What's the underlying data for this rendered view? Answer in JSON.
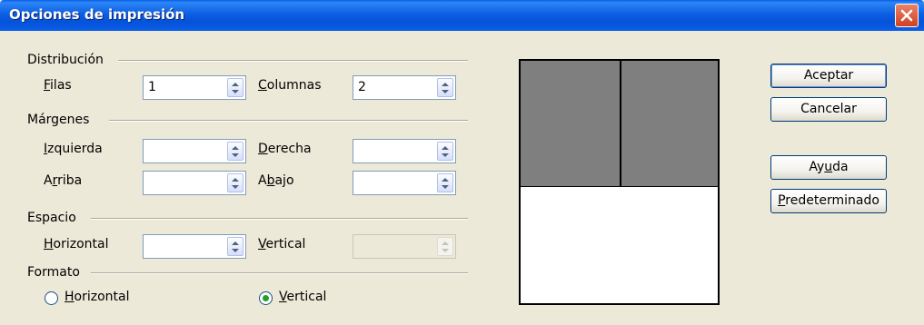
{
  "window": {
    "title": "Opciones de impresión"
  },
  "distribucion": {
    "group_label": "Distribución",
    "filas_label": "Filas",
    "filas_value": "1",
    "columnas_label": "Columnas",
    "columnas_value": "2"
  },
  "margenes": {
    "group_label": "Márgenes",
    "izquierda_label": "Izquierda",
    "derecha_label": "Derecha",
    "arriba_label": "Arriba",
    "abajo_label": "Abajo"
  },
  "espacio": {
    "group_label": "Espacio",
    "horizontal_label": "Horizontal",
    "vertical_label": "Vertical"
  },
  "formato": {
    "group_label": "Formato",
    "horizontal_label": "Horizontal",
    "vertical_label": "Vertical",
    "selected": "Vertical"
  },
  "buttons": {
    "aceptar": "Aceptar",
    "cancelar": "Cancelar",
    "ayuda": "Ayuda",
    "predeterminado": "Predeterminado"
  },
  "colors": {
    "titlebar": "#0a5de8",
    "dialog_bg": "#ece9d8",
    "radio_dot": "#21a121",
    "page_preview": "#7f7f7f"
  },
  "icons": {
    "close": "close-icon",
    "spin": "spin-arrows-icon"
  }
}
